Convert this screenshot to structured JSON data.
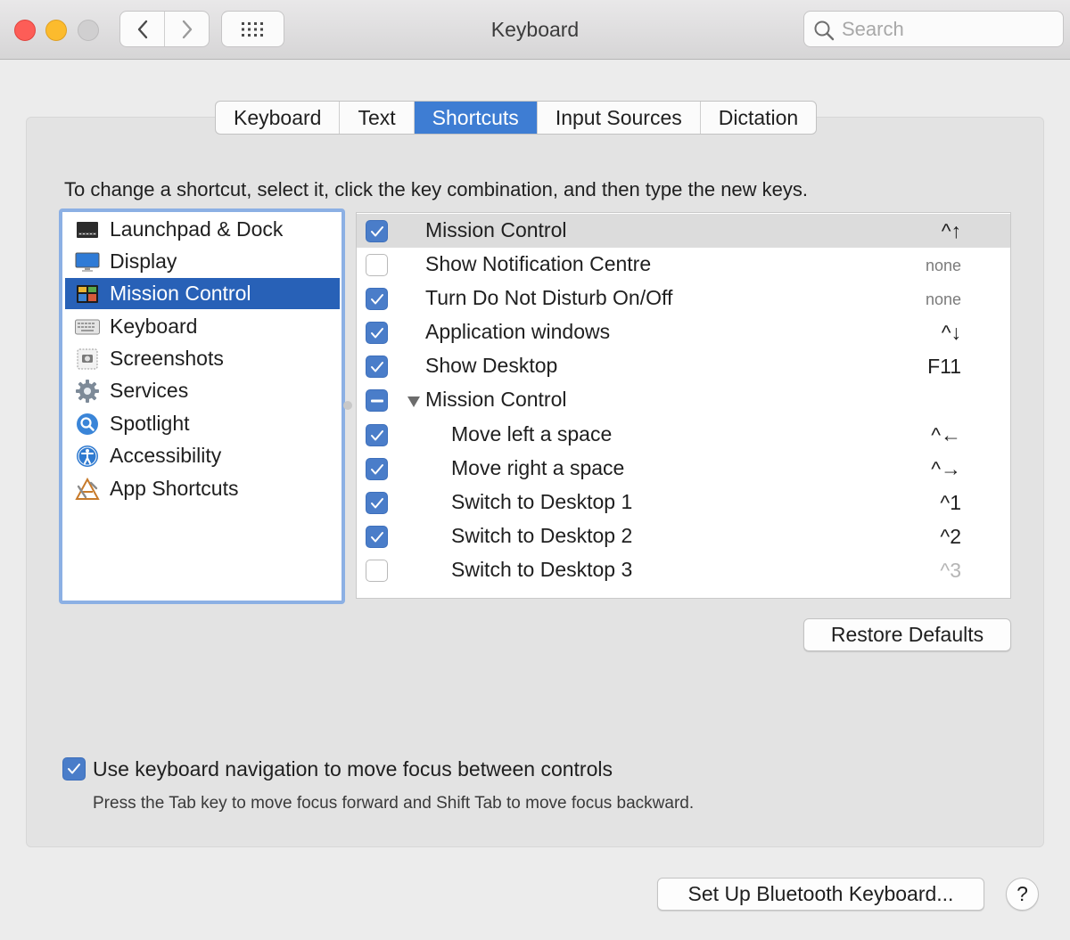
{
  "window": {
    "title": "Keyboard",
    "search_placeholder": "Search"
  },
  "tabs": [
    {
      "label": "Keyboard",
      "active": false
    },
    {
      "label": "Text",
      "active": false
    },
    {
      "label": "Shortcuts",
      "active": true
    },
    {
      "label": "Input Sources",
      "active": false
    },
    {
      "label": "Dictation",
      "active": false
    }
  ],
  "instructions": "To change a shortcut, select it, click the key combination, and then type the new keys.",
  "categories": [
    {
      "label": "Launchpad & Dock",
      "icon": "launchpad-dock-icon",
      "selected": false
    },
    {
      "label": "Display",
      "icon": "display-icon",
      "selected": false
    },
    {
      "label": "Mission Control",
      "icon": "mission-control-icon",
      "selected": true
    },
    {
      "label": "Keyboard",
      "icon": "keyboard-icon",
      "selected": false
    },
    {
      "label": "Screenshots",
      "icon": "screenshots-icon",
      "selected": false
    },
    {
      "label": "Services",
      "icon": "gear-icon",
      "selected": false
    },
    {
      "label": "Spotlight",
      "icon": "magnifier-icon",
      "selected": false
    },
    {
      "label": "Accessibility",
      "icon": "accessibility-icon",
      "selected": false
    },
    {
      "label": "App Shortcuts",
      "icon": "app-shortcuts-icon",
      "selected": false
    }
  ],
  "shortcuts": [
    {
      "label": "Mission Control",
      "key": "^↑",
      "checked": "on",
      "indent": false,
      "highlighted": true
    },
    {
      "label": "Show Notification Centre",
      "key": "none",
      "checked": "off",
      "indent": false
    },
    {
      "label": "Turn Do Not Disturb On/Off",
      "key": "none",
      "checked": "on",
      "indent": false
    },
    {
      "label": "Application windows",
      "key": "^↓",
      "checked": "on",
      "indent": false
    },
    {
      "label": "Show Desktop",
      "key": "F11",
      "checked": "on",
      "indent": false
    },
    {
      "label": "Mission Control",
      "key": "",
      "checked": "mixed",
      "indent": false,
      "group": true
    },
    {
      "label": "Move left a space",
      "key": "^←",
      "checked": "on",
      "indent": true
    },
    {
      "label": "Move right a space",
      "key": "^→",
      "checked": "on",
      "indent": true
    },
    {
      "label": "Switch to Desktop 1",
      "key": "^1",
      "checked": "on",
      "indent": true
    },
    {
      "label": "Switch to Desktop 2",
      "key": "^2",
      "checked": "on",
      "indent": true
    },
    {
      "label": "Switch to Desktop 3",
      "key": "^3",
      "checked": "off",
      "indent": true,
      "dim": true
    }
  ],
  "restore_defaults": "Restore Defaults",
  "keyboard_nav": {
    "label": "Use keyboard navigation to move focus between controls",
    "hint": "Press the Tab key to move focus forward and Shift Tab to move focus backward.",
    "checked": true
  },
  "bluetooth_button": "Set Up Bluetooth Keyboard...",
  "help_button": "?",
  "colors": {
    "accent": "#3e7dd3",
    "selection": "#2861b7",
    "checkbox": "#4a7dc9"
  }
}
